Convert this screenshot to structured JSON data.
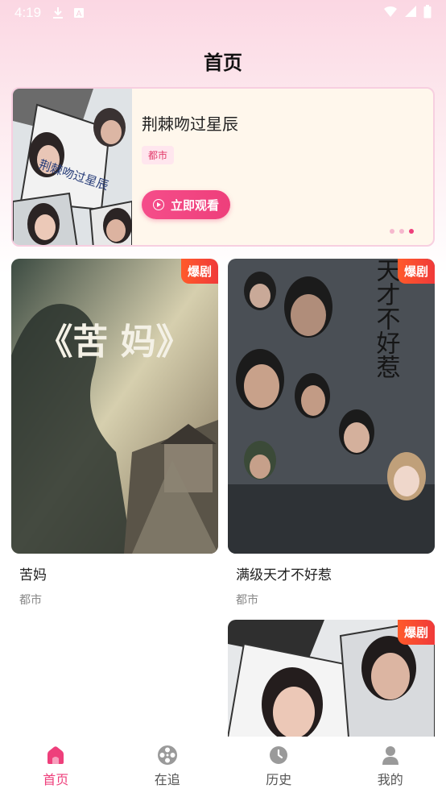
{
  "status_bar": {
    "time": "4:19",
    "icons": [
      "download-icon",
      "a-box-icon",
      "wifi-icon",
      "signal-icon",
      "battery-icon"
    ]
  },
  "header": {
    "title": "首页"
  },
  "banner": {
    "title": "荆棘吻过星辰",
    "tag": "都市",
    "button_label": "立即观看",
    "poster_text": "荆棘吻过星辰",
    "dots_count": 3,
    "active_dot": 2
  },
  "cards": [
    {
      "title": "苦妈",
      "tag": "都市",
      "badge": "爆剧",
      "poster_text": "《苦 妈》"
    },
    {
      "title": "满级天才不好惹",
      "tag": "都市",
      "badge": "爆剧",
      "poster_text": "满级天才不好惹"
    },
    {
      "title": "",
      "tag": "",
      "badge": "爆剧"
    }
  ],
  "bottom_nav": [
    {
      "label": "首页",
      "icon": "home-icon",
      "active": true
    },
    {
      "label": "在追",
      "icon": "film-reel-icon",
      "active": false
    },
    {
      "label": "历史",
      "icon": "clock-icon",
      "active": false
    },
    {
      "label": "我的",
      "icon": "user-icon",
      "active": false
    }
  ],
  "colors": {
    "accent": "#ee3f7b",
    "badge": "#f03a3a",
    "banner_bg": "#fff7ec"
  }
}
